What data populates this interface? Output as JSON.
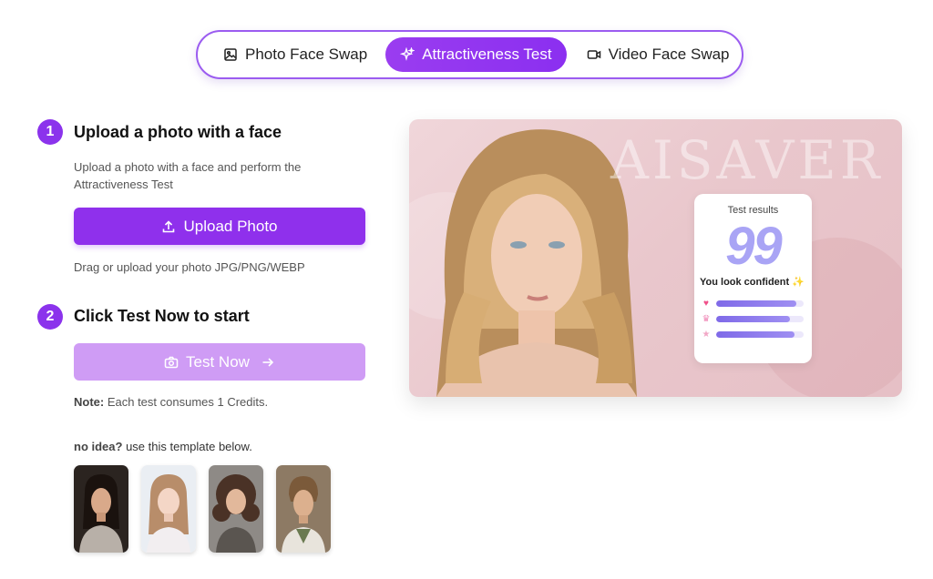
{
  "tabs": [
    {
      "label": "Photo Face Swap",
      "icon": "image-icon",
      "active": false
    },
    {
      "label": "Attractiveness Test",
      "icon": "sparkle-icon",
      "active": true
    },
    {
      "label": "Video Face Swap",
      "icon": "video-camera-icon",
      "active": false
    }
  ],
  "step1": {
    "number": "1",
    "title": "Upload a photo with a face",
    "description": "Upload a photo with a face and perform the Attractiveness Test",
    "button_label": "Upload Photo",
    "hint": "Drag or upload your photo JPG/PNG/WEBP"
  },
  "step2": {
    "number": "2",
    "title": "Click Test Now to start",
    "button_label": "Test Now",
    "note_label": "Note:",
    "note_text": " Each test consumes 1 Credits."
  },
  "templates": {
    "prompt_bold": "no idea?",
    "prompt_text": " use this template below.",
    "items": [
      {
        "icon": "portrait-woman-dark-hair"
      },
      {
        "icon": "portrait-woman-light-hair"
      },
      {
        "icon": "portrait-woman-curly-hair"
      },
      {
        "icon": "portrait-man"
      }
    ]
  },
  "preview": {
    "watermark": "AISAVER",
    "results_label": "Test results",
    "score": "99",
    "message": "You look confident ✨",
    "bars": [
      {
        "icon": "heart-icon",
        "color": "#f0508a",
        "level": 0.92
      },
      {
        "icon": "crown-icon",
        "color": "#f08ab8",
        "level": 0.84
      },
      {
        "icon": "star-icon",
        "color": "#f2a7c6",
        "level": 0.9
      }
    ]
  },
  "colors": {
    "accent": "#8f30ec",
    "accent_light": "#cf9cf5",
    "score": "#a9a4f5"
  }
}
